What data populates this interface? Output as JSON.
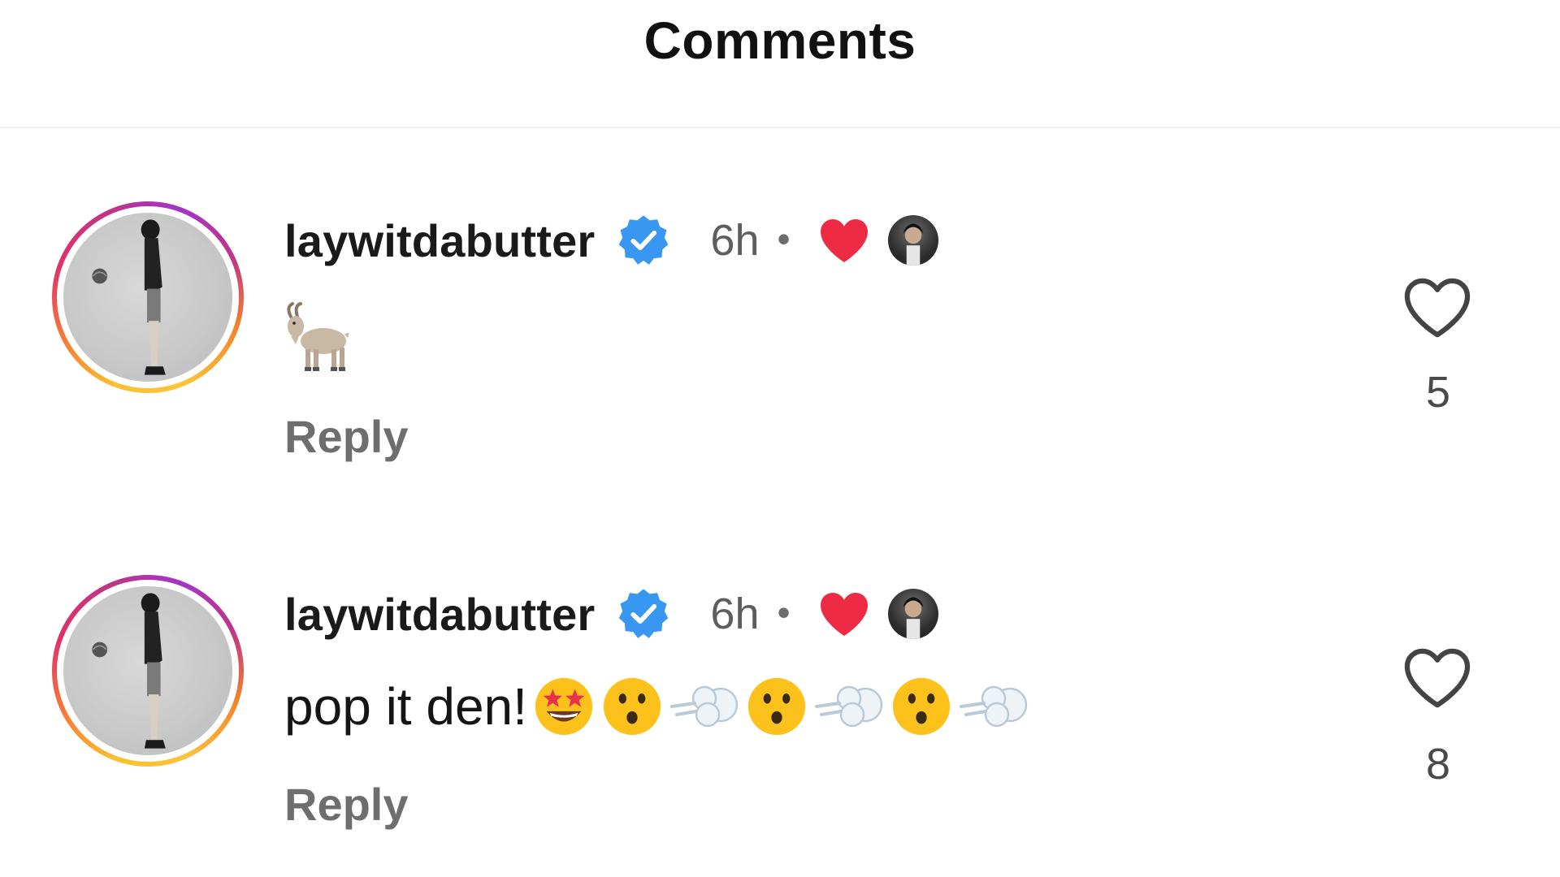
{
  "header": {
    "title": "Comments"
  },
  "comments": [
    {
      "username": "laywitdabutter",
      "verified": true,
      "time": "6h",
      "separator": "•",
      "text": "",
      "emojis": [
        "goat"
      ],
      "reply_label": "Reply",
      "like_count": "5",
      "liked_by_author": true
    },
    {
      "username": "laywitdabutter",
      "verified": true,
      "time": "6h",
      "separator": "•",
      "text": "pop it den!",
      "emojis": [
        "star-struck",
        "hushed-face",
        "dashing-away",
        "hushed-face",
        "dashing-away",
        "hushed-face",
        "dashing-away"
      ],
      "reply_label": "Reply",
      "like_count": "8",
      "liked_by_author": true
    }
  ],
  "colors": {
    "verified_blue": "#3897f0",
    "heart_red": "#ed2b45",
    "secondary_text": "#6e6e6e"
  }
}
